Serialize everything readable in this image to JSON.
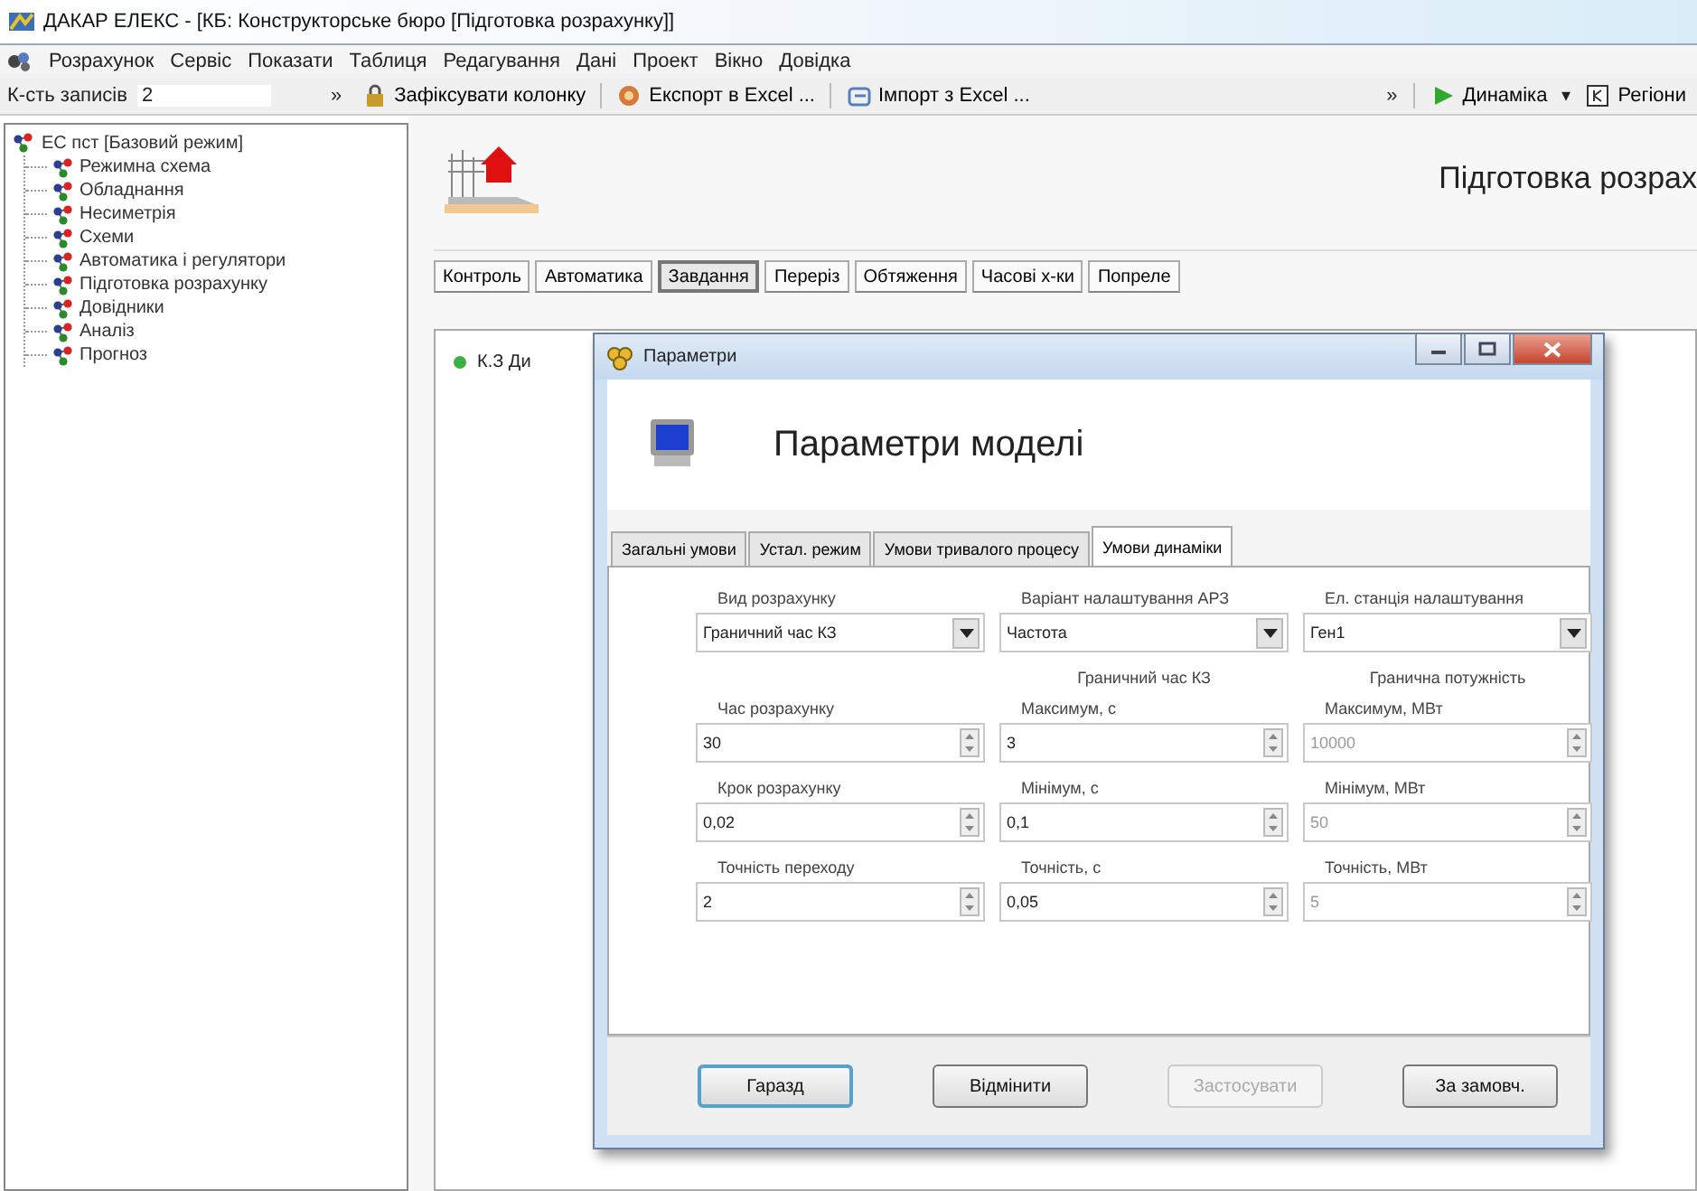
{
  "window": {
    "title": "ДАКАР ЕЛЕКС - [КБ: Конструкторське бюро [Підготовка розрахунку]]"
  },
  "menu": [
    "Розрахунок",
    "Сервіс",
    "Показати",
    "Таблиця",
    "Редагування",
    "Дані",
    "Проект",
    "Вікно",
    "Довідка"
  ],
  "toolbar": {
    "records_label": "К-сть записів",
    "records_value": "2",
    "overflow": "»",
    "buttons": [
      {
        "kind": "lock",
        "label": "Зафіксувати колонку"
      },
      {
        "kind": "export",
        "label": "Експорт в Excel ..."
      },
      {
        "kind": "import",
        "label": "Імпорт з Excel ..."
      }
    ],
    "overflow_2": "»",
    "right": [
      {
        "kind": "play",
        "label": "Динаміка"
      },
      {
        "kind": "caret",
        "label": "▾"
      },
      {
        "kind": "region",
        "label": "Регіони"
      }
    ]
  },
  "tree": {
    "label": "ЕС пст [Базовий режим]",
    "children": [
      {
        "label": "Режимна схема"
      },
      {
        "label": "Обладнання"
      },
      {
        "label": "Несиметрія"
      },
      {
        "label": "Схеми"
      },
      {
        "label": "Автоматика і регулятори"
      },
      {
        "label": "Підготовка розрахунку"
      },
      {
        "label": "Довідники"
      },
      {
        "label": "Аналіз"
      },
      {
        "label": "Прогноз"
      }
    ]
  },
  "page": {
    "title": "Підготовка розрах",
    "tabs": [
      {
        "label": "Контроль",
        "selected": false
      },
      {
        "label": "Автоматика",
        "selected": false
      },
      {
        "label": "Завдання",
        "selected": true
      },
      {
        "label": "Переріз",
        "selected": false
      },
      {
        "label": "Обтяження",
        "selected": false
      },
      {
        "label": "Часові х-ки",
        "selected": false
      },
      {
        "label": "Попреле",
        "selected": false
      }
    ],
    "items": [
      {
        "label": "К.З Ди",
        "color": "#3cb043"
      }
    ]
  },
  "dialog": {
    "title": "Параметри",
    "heading": "Параметри моделі",
    "tabs": [
      {
        "label": "Загальні умови",
        "selected": false
      },
      {
        "label": "Устал. режим",
        "selected": false
      },
      {
        "label": "Умови тривалого процесу",
        "selected": false
      },
      {
        "label": "Умови динаміки",
        "selected": true
      }
    ],
    "groups": [
      "Граничний час КЗ",
      "Гранична потужність"
    ],
    "fields": [
      {
        "kind": "combo",
        "label": "Вид розрахунку",
        "value": "Граничний час КЗ",
        "disabled": false
      },
      {
        "kind": "combo",
        "label": "Варіант налаштування АРЗ",
        "value": "Частота",
        "disabled": false
      },
      {
        "kind": "combo",
        "label": "Ел. станція налаштування",
        "value": "Ген1",
        "disabled": false
      },
      {
        "kind": "spin",
        "label": "Час розрахунку",
        "value": "30",
        "disabled": false
      },
      {
        "kind": "spin",
        "label": "Максимум, с",
        "value": "3",
        "disabled": false
      },
      {
        "kind": "spin",
        "label": "Максимум, МВт",
        "value": "10000",
        "disabled": true
      },
      {
        "kind": "spin",
        "label": "Крок розрахунку",
        "value": "0,02",
        "disabled": false
      },
      {
        "kind": "spin",
        "label": "Мінімум, с",
        "value": "0,1",
        "disabled": false
      },
      {
        "kind": "spin",
        "label": "Мінімум, МВт",
        "value": "50",
        "disabled": true
      },
      {
        "kind": "spin",
        "label": "Точність переходу",
        "value": "2",
        "disabled": false
      },
      {
        "kind": "spin",
        "label": "Точність, с",
        "value": "0,05",
        "disabled": false
      },
      {
        "kind": "spin",
        "label": "Точність, МВт",
        "value": "5",
        "disabled": true
      }
    ],
    "buttons": [
      {
        "label": "Гаразд",
        "default": true,
        "disabled": false
      },
      {
        "label": "Відмінити",
        "default": false,
        "disabled": false
      },
      {
        "label": "Застосувати",
        "default": false,
        "disabled": true
      },
      {
        "label": "За замовч.",
        "default": false,
        "disabled": false
      }
    ]
  }
}
